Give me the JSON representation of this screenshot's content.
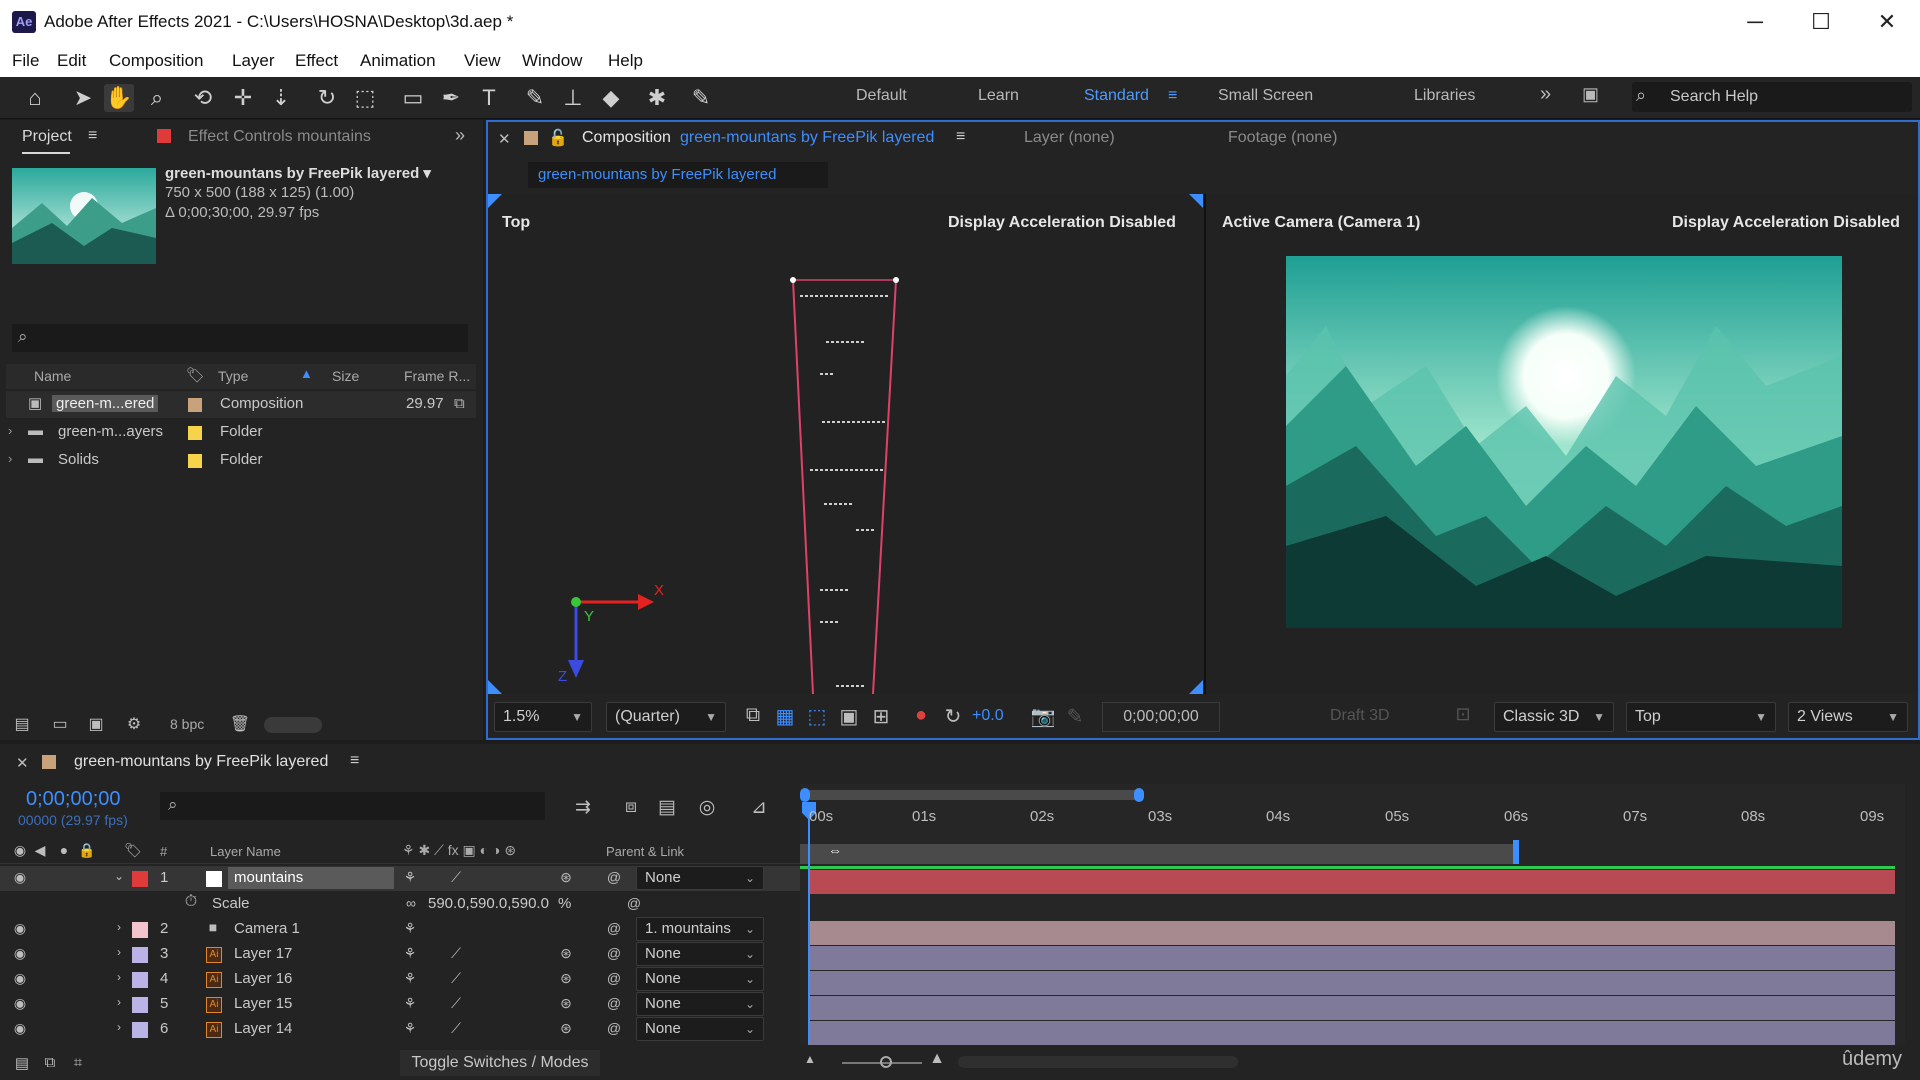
{
  "app": {
    "logo": "Ae",
    "title": "Adobe After Effects 2021 - C:\\Users\\HOSNA\\Desktop\\3d.aep *",
    "window_controls": {
      "minimize": "─",
      "maximize": "☐",
      "close": "✕"
    }
  },
  "menu": [
    "File",
    "Edit",
    "Composition",
    "Layer",
    "Effect",
    "Animation",
    "View",
    "Window",
    "Help"
  ],
  "toolbar": {
    "tools": [
      "home-icon",
      "selection-icon",
      "hand-icon",
      "zoom-icon",
      "orbit-icon",
      "pan-icon",
      "dolly-icon",
      "rotate-icon",
      "pan-behind-icon",
      "rectangle-icon",
      "pen-icon",
      "type-icon",
      "brush-icon",
      "clone-stamp-icon",
      "eraser-icon",
      "roto-brush-icon",
      "puppet-pin-icon"
    ],
    "workspaces": [
      "Default",
      "Learn",
      "Standard",
      "Small Screen",
      "Libraries"
    ],
    "active_workspace": "Standard",
    "more_glyph": "»",
    "search_placeholder": "Search Help"
  },
  "project": {
    "tab_label": "Project",
    "effect_controls_label": "Effect Controls mountains",
    "comp_name": "green-mountans by FreePik layered ▾",
    "comp_dims": "750 x 500  (188 x 125) (1.00)",
    "comp_duration": "Δ 0;00;30;00, 29.97 fps",
    "columns": [
      "Name",
      "Type",
      "Size",
      "Frame R..."
    ],
    "items": [
      {
        "name": "green-m...ered",
        "type": "Composition",
        "rate": "29.97",
        "color": "#c7a27a"
      },
      {
        "name": "green-m...ayers",
        "type": "Folder",
        "rate": "",
        "color": "#f5d34a"
      },
      {
        "name": "Solids",
        "type": "Folder",
        "rate": "",
        "color": "#f5d34a"
      }
    ],
    "bpc": "8 bpc"
  },
  "composition": {
    "tab_prefix": "Composition",
    "tab_name": "green-mountans by FreePik layered",
    "layer_tab": "Layer (none)",
    "footage_tab": "Footage (none)",
    "breadcrumb": "green-mountans by FreePik layered",
    "left_view_label": "Top",
    "left_view_warning": "Display Acceleration Disabled",
    "right_view_label": "Active Camera (Camera 1)",
    "right_view_warning": "Display Acceleration Disabled",
    "axis_x": "X",
    "axis_y": "Y",
    "axis_z": "Z",
    "zoom": "1.5%",
    "resolution": "(Quarter)",
    "exposure": "+0.0",
    "timecode": "0;00;00;00",
    "draft3d": "Draft 3D",
    "renderer": "Classic 3D",
    "view": "Top",
    "views": "2 Views"
  },
  "timeline": {
    "tab_name": "green-mountans by FreePik layered",
    "timecode": "0;00;00;00",
    "subcode": "00000 (29.97 fps)",
    "col_number": "#",
    "col_layer_name": "Layer Name",
    "col_parent": "Parent & Link",
    "ruler": [
      "00s",
      "01s",
      "02s",
      "03s",
      "04s",
      "05s",
      "06s",
      "07s",
      "08s",
      "09s"
    ],
    "layers": [
      {
        "num": "1",
        "name": "mountains",
        "parent": "None",
        "color": "#ffffff",
        "type": "solid"
      },
      {
        "num": "2",
        "name": "Camera 1",
        "parent": "1. mountains",
        "color": "#f3c4cd",
        "type": "camera"
      },
      {
        "num": "3",
        "name": "Layer 17",
        "parent": "None",
        "color": "#b9b3e6",
        "type": "ai"
      },
      {
        "num": "4",
        "name": "Layer 16",
        "parent": "None",
        "color": "#b9b3e6",
        "type": "ai"
      },
      {
        "num": "5",
        "name": "Layer 15",
        "parent": "None",
        "color": "#b9b3e6",
        "type": "ai"
      },
      {
        "num": "6",
        "name": "Layer 14",
        "parent": "None",
        "color": "#b9b3e6",
        "type": "ai"
      }
    ],
    "scale_label": "Scale",
    "scale_value": "590.0,590.0,590.0",
    "scale_unit": "%",
    "toggle_label": "Toggle Switches / Modes"
  },
  "watermark": "ûdemy"
}
